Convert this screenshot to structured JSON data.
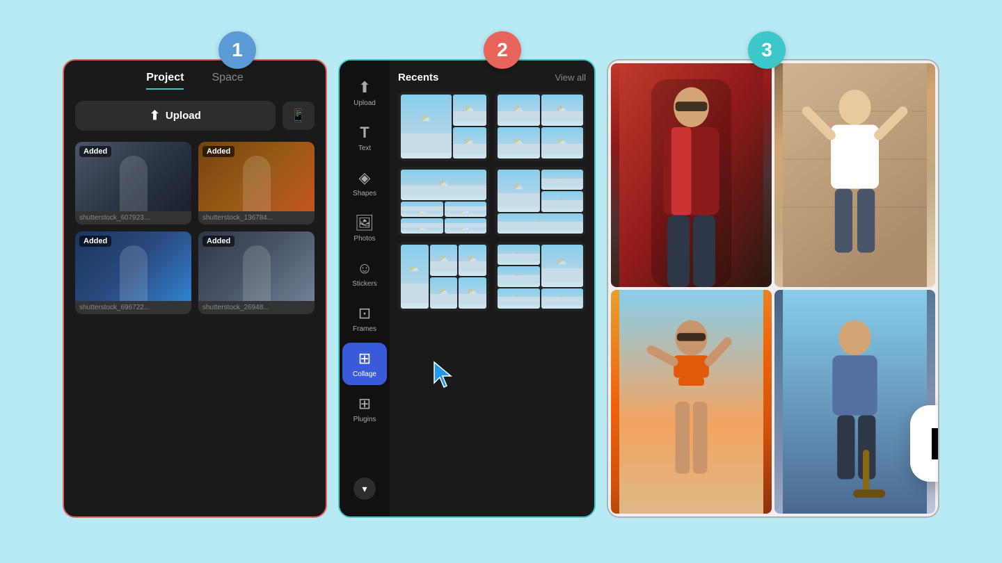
{
  "background": "#b8eaf4",
  "steps": [
    {
      "number": "1",
      "color": "#5b9bd5"
    },
    {
      "number": "2",
      "color": "#e8645a"
    },
    {
      "number": "3",
      "color": "#3cc8c8"
    }
  ],
  "panel1": {
    "tabs": [
      {
        "label": "Project",
        "active": true
      },
      {
        "label": "Space",
        "active": false
      }
    ],
    "upload_button": "Upload",
    "photos": [
      {
        "added": true,
        "label": "shutterstock_607923..."
      },
      {
        "added": true,
        "label": "shutterstock_136784..."
      },
      {
        "added": true,
        "label": "shutterstock_696722..."
      },
      {
        "added": true,
        "label": "shutterstock_26948..."
      }
    ]
  },
  "panel2": {
    "sidebar": [
      {
        "icon": "⬆",
        "label": "Upload",
        "active": false
      },
      {
        "icon": "T",
        "label": "Text",
        "active": false
      },
      {
        "icon": "✦",
        "label": "Shapes",
        "active": false
      },
      {
        "icon": "🖼",
        "label": "Photos",
        "active": false
      },
      {
        "icon": "🙂",
        "label": "Stickers",
        "active": false
      },
      {
        "icon": "⊡",
        "label": "Frames",
        "active": false
      },
      {
        "icon": "⊞",
        "label": "Collage",
        "active": true
      },
      {
        "icon": "⊞",
        "label": "Plugins",
        "active": false
      }
    ],
    "recents_title": "Recents",
    "view_all": "View all",
    "collage_label": "Collage"
  },
  "panel3": {
    "photos": [
      "Fashion model in red plaid",
      "Fashion model in white top",
      "Fashion model in orange",
      "Fashion model with skateboard"
    ]
  },
  "app_icon": "CapCut"
}
